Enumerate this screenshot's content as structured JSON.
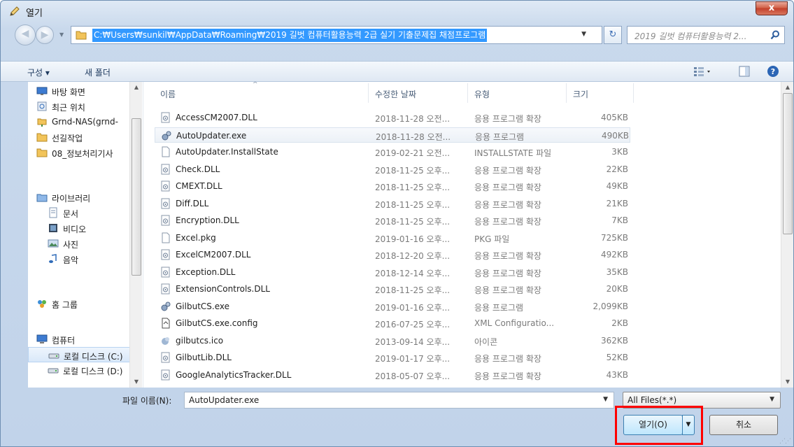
{
  "window": {
    "title": "열기",
    "close_label": "x"
  },
  "address": {
    "path": "C:₩Users₩sunkil₩AppData₩Roaming₩2019 길벗 컴퓨터활용능력 2급 실기 기출문제집 채점프로그램",
    "search_placeholder": "2019 길벗 컴퓨터활용능력 2..."
  },
  "toolbar": {
    "organize_label": "구성 ▾",
    "new_folder_label": "새 폴더"
  },
  "sidebar": {
    "items": [
      {
        "label": "바탕 화면",
        "icon": "desktop-icon"
      },
      {
        "label": "최근 위치",
        "icon": "recent-places-icon"
      },
      {
        "label": "Grnd-NAS(grnd-",
        "icon": "network-folder-icon"
      },
      {
        "label": "선길작업",
        "icon": "folder-icon"
      },
      {
        "label": "08_정보처리기사",
        "icon": "folder-icon"
      },
      {
        "label": "라이브러리",
        "icon": "library-icon"
      },
      {
        "label": "문서",
        "icon": "documents-icon"
      },
      {
        "label": "비디오",
        "icon": "video-icon"
      },
      {
        "label": "사진",
        "icon": "pictures-icon"
      },
      {
        "label": "음악",
        "icon": "music-icon"
      },
      {
        "label": "홈 그룹",
        "icon": "homegroup-icon"
      },
      {
        "label": "컴퓨터",
        "icon": "computer-icon"
      },
      {
        "label": "로컬 디스크 (C:)",
        "icon": "drive-icon"
      },
      {
        "label": "로컬 디스크 (D:)",
        "icon": "drive-icon"
      }
    ]
  },
  "columns": {
    "name": "이름",
    "date": "수정한 날짜",
    "type": "유형",
    "size": "크기"
  },
  "files": [
    {
      "name": "AccessCM2007.DLL",
      "date": "2018-11-28 오전...",
      "type": "응용 프로그램 확장",
      "size": "405KB",
      "icon": "dll-icon"
    },
    {
      "name": "AutoUpdater.exe",
      "date": "2018-11-28 오전...",
      "type": "응용 프로그램",
      "size": "490KB",
      "icon": "exe-icon"
    },
    {
      "name": "AutoUpdater.InstallState",
      "date": "2019-02-21 오전...",
      "type": "INSTALLSTATE 파일",
      "size": "3KB",
      "icon": "file-icon"
    },
    {
      "name": "Check.DLL",
      "date": "2018-11-25 오후...",
      "type": "응용 프로그램 확장",
      "size": "22KB",
      "icon": "dll-icon"
    },
    {
      "name": "CMEXT.DLL",
      "date": "2018-11-25 오후...",
      "type": "응용 프로그램 확장",
      "size": "49KB",
      "icon": "dll-icon"
    },
    {
      "name": "Diff.DLL",
      "date": "2018-11-25 오후...",
      "type": "응용 프로그램 확장",
      "size": "21KB",
      "icon": "dll-icon"
    },
    {
      "name": "Encryption.DLL",
      "date": "2018-11-25 오후...",
      "type": "응용 프로그램 확장",
      "size": "7KB",
      "icon": "dll-icon"
    },
    {
      "name": "Excel.pkg",
      "date": "2019-01-16 오후...",
      "type": "PKG 파일",
      "size": "725KB",
      "icon": "file-icon"
    },
    {
      "name": "ExcelCM2007.DLL",
      "date": "2018-12-20 오후...",
      "type": "응용 프로그램 확장",
      "size": "492KB",
      "icon": "dll-icon"
    },
    {
      "name": "Exception.DLL",
      "date": "2018-12-14 오후...",
      "type": "응용 프로그램 확장",
      "size": "35KB",
      "icon": "dll-icon"
    },
    {
      "name": "ExtensionControls.DLL",
      "date": "2018-11-25 오후...",
      "type": "응용 프로그램 확장",
      "size": "20KB",
      "icon": "dll-icon"
    },
    {
      "name": "GilbutCS.exe",
      "date": "2019-01-16 오후...",
      "type": "응용 프로그램",
      "size": "2,099KB",
      "icon": "exe-icon"
    },
    {
      "name": "GilbutCS.exe.config",
      "date": "2016-07-25 오후...",
      "type": "XML Configuratio...",
      "size": "2KB",
      "icon": "config-icon"
    },
    {
      "name": "gilbutcs.ico",
      "date": "2013-09-14 오후...",
      "type": "아이콘",
      "size": "362KB",
      "icon": "ico-file-icon"
    },
    {
      "name": "GilbutLib.DLL",
      "date": "2019-01-17 오후...",
      "type": "응용 프로그램 확장",
      "size": "52KB",
      "icon": "dll-icon"
    },
    {
      "name": "GoogleAnalyticsTracker.DLL",
      "date": "2018-05-07 오후...",
      "type": "응용 프로그램 확장",
      "size": "43KB",
      "icon": "dll-icon"
    }
  ],
  "bottom": {
    "filename_label": "파일 이름(N):",
    "filename_value": "AutoUpdater.exe",
    "filetype_value": "All Files(*.*)",
    "open_label": "열기(O)",
    "cancel_label": "취소"
  },
  "colors": {
    "selection_blue": "#3399ff",
    "highlight_red": "#ff0000"
  }
}
